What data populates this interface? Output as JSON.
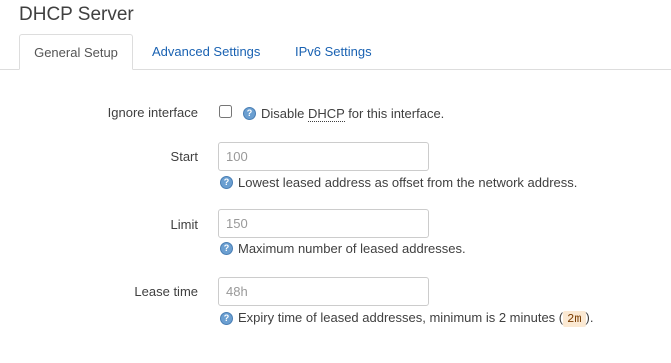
{
  "page": {
    "title": "DHCP Server"
  },
  "tabs": [
    {
      "label": "General Setup",
      "active": true
    },
    {
      "label": "Advanced Settings",
      "active": false
    },
    {
      "label": "IPv6 Settings",
      "active": false
    }
  ],
  "fields": {
    "ignore_interface": {
      "label": "Ignore interface",
      "checked": false,
      "help_prefix": "Disable ",
      "help_abbr": "DHCP",
      "help_suffix": " for this interface."
    },
    "start": {
      "label": "Start",
      "placeholder": "100",
      "value": "",
      "help": "Lowest leased address as offset from the network address."
    },
    "limit": {
      "label": "Limit",
      "placeholder": "150",
      "value": "",
      "help": "Maximum number of leased addresses."
    },
    "lease_time": {
      "label": "Lease time",
      "placeholder": "48h",
      "value": "",
      "help_prefix": "Expiry time of leased addresses, minimum is 2 minutes (",
      "help_code": "2m",
      "help_suffix": ")."
    }
  },
  "icons": {
    "help": "help-icon"
  },
  "colors": {
    "link": "#1a62b2",
    "help_icon": "#6b9fd1",
    "code_bg": "#fbe9d3"
  }
}
